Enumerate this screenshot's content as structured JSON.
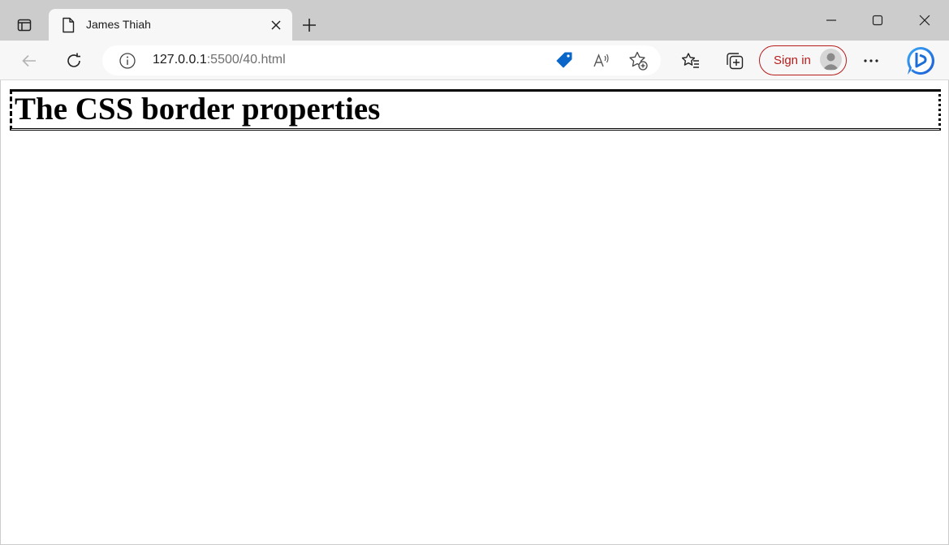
{
  "tab": {
    "title": "James Thiah"
  },
  "address": {
    "host": "127.0.0.1",
    "rest": ":5500/40.html"
  },
  "toolbar": {
    "signin_label": "Sign in"
  },
  "page": {
    "heading": "The CSS border properties"
  },
  "colors": {
    "signin_accent": "#b71c1c",
    "coupon_blue": "#0a66c8",
    "chrome_gray": "#cccccc",
    "toolbar_bg": "#f7f7f7"
  },
  "icons": [
    "tab-actions-icon",
    "page-icon",
    "close-tab-icon",
    "new-tab-icon",
    "minimize-icon",
    "maximize-icon",
    "window-close-icon",
    "back-icon",
    "refresh-icon",
    "info-icon",
    "coupon-icon",
    "read-aloud-icon",
    "add-favorite-icon",
    "favorites-icon",
    "collections-icon",
    "profile-avatar-icon",
    "more-icon",
    "copilot-icon"
  ]
}
